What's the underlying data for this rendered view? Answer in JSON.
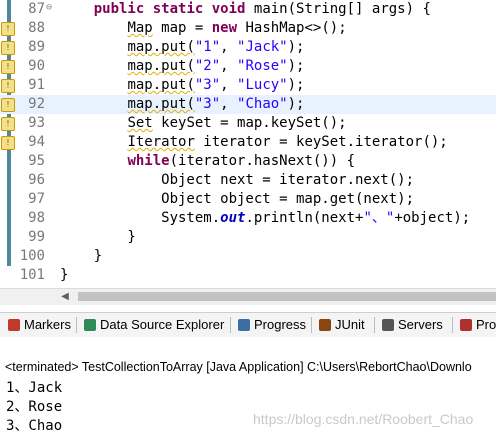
{
  "editor": {
    "lines": [
      {
        "no": "87",
        "tokens": [
          {
            "t": "    ",
            "c": ""
          },
          {
            "t": "public",
            "c": "kw"
          },
          {
            "t": " ",
            "c": ""
          },
          {
            "t": "static",
            "c": "kw"
          },
          {
            "t": " ",
            "c": ""
          },
          {
            "t": "void",
            "c": "kw"
          },
          {
            "t": " main(String[] args) {",
            "c": ""
          }
        ]
      },
      {
        "no": "88",
        "tokens": [
          {
            "t": "        ",
            "c": ""
          },
          {
            "t": "Map",
            "c": "wav"
          },
          {
            "t": " map = ",
            "c": ""
          },
          {
            "t": "new",
            "c": "kw"
          },
          {
            "t": " HashMap<>();",
            "c": ""
          }
        ]
      },
      {
        "no": "89",
        "tokens": [
          {
            "t": "        ",
            "c": ""
          },
          {
            "t": "map.put(",
            "c": "wav"
          },
          {
            "t": "\"1\"",
            "c": "str"
          },
          {
            "t": ", ",
            "c": ""
          },
          {
            "t": "\"Jack\"",
            "c": "str"
          },
          {
            "t": ");",
            "c": ""
          }
        ]
      },
      {
        "no": "90",
        "tokens": [
          {
            "t": "        ",
            "c": ""
          },
          {
            "t": "map.put(",
            "c": "wav"
          },
          {
            "t": "\"2\"",
            "c": "str"
          },
          {
            "t": ", ",
            "c": ""
          },
          {
            "t": "\"Rose\"",
            "c": "str"
          },
          {
            "t": ");",
            "c": ""
          }
        ]
      },
      {
        "no": "91",
        "tokens": [
          {
            "t": "        ",
            "c": ""
          },
          {
            "t": "map.put(",
            "c": "wav"
          },
          {
            "t": "\"3\"",
            "c": "str"
          },
          {
            "t": ", ",
            "c": ""
          },
          {
            "t": "\"Lucy\"",
            "c": "str"
          },
          {
            "t": ");",
            "c": ""
          }
        ]
      },
      {
        "no": "92",
        "tokens": [
          {
            "t": "        ",
            "c": ""
          },
          {
            "t": "map.put(",
            "c": "wav"
          },
          {
            "t": "\"3\"",
            "c": "str"
          },
          {
            "t": ", ",
            "c": ""
          },
          {
            "t": "\"Chao\"",
            "c": "str"
          },
          {
            "t": ");",
            "c": ""
          }
        ]
      },
      {
        "no": "93",
        "tokens": [
          {
            "t": "        ",
            "c": ""
          },
          {
            "t": "Set",
            "c": "wav"
          },
          {
            "t": " keySet = map.keySet();",
            "c": ""
          }
        ]
      },
      {
        "no": "94",
        "tokens": [
          {
            "t": "        ",
            "c": ""
          },
          {
            "t": "Iterator",
            "c": "wav"
          },
          {
            "t": " iterator = keySet.iterator();",
            "c": ""
          }
        ]
      },
      {
        "no": "95",
        "tokens": [
          {
            "t": "        ",
            "c": ""
          },
          {
            "t": "while",
            "c": "kw"
          },
          {
            "t": "(iterator.hasNext()) {",
            "c": ""
          }
        ]
      },
      {
        "no": "96",
        "tokens": [
          {
            "t": "            Object next = iterator.next();",
            "c": ""
          }
        ]
      },
      {
        "no": "97",
        "tokens": [
          {
            "t": "            Object object = map.get(next);",
            "c": ""
          }
        ]
      },
      {
        "no": "98",
        "tokens": [
          {
            "t": "            System.",
            "c": ""
          },
          {
            "t": "out",
            "c": "st"
          },
          {
            "t": ".println(next+",
            "c": ""
          },
          {
            "t": "\"、\"",
            "c": "str"
          },
          {
            "t": "+object);",
            "c": ""
          }
        ]
      },
      {
        "no": "99",
        "tokens": [
          {
            "t": "        }",
            "c": ""
          }
        ]
      },
      {
        "no": "100",
        "tokens": [
          {
            "t": "    }",
            "c": ""
          }
        ]
      },
      {
        "no": "101",
        "tokens": [
          {
            "t": "}",
            "c": ""
          }
        ]
      }
    ],
    "warning_lines": [
      "88",
      "89",
      "90",
      "91",
      "92",
      "93",
      "94"
    ],
    "fold_line": "87",
    "fold_icon": "⊖",
    "current_line": "92"
  },
  "views_tabs": [
    {
      "label": "Markers",
      "icon": "markers-icon",
      "color": "#c0392b"
    },
    {
      "label": "Data Source Explorer",
      "icon": "data-source-icon",
      "color": "#2e8b57"
    },
    {
      "label": "Progress",
      "icon": "progress-icon",
      "color": "#3a6ea5"
    },
    {
      "label": "JUnit",
      "icon": "junit-icon",
      "color": "#8b4513"
    },
    {
      "label": "Servers",
      "icon": "servers-icon",
      "color": "#555555"
    },
    {
      "label": "Proble",
      "icon": "problems-icon",
      "color": "#b03030"
    }
  ],
  "console": {
    "status": "<terminated> TestCollectionToArray [Java Application] C:\\Users\\RebortChao\\Downlo",
    "output": [
      "1、Jack",
      "2、Rose",
      "3、Chao"
    ]
  },
  "watermark": "https://blog.csdn.net/Roobert_Chao"
}
